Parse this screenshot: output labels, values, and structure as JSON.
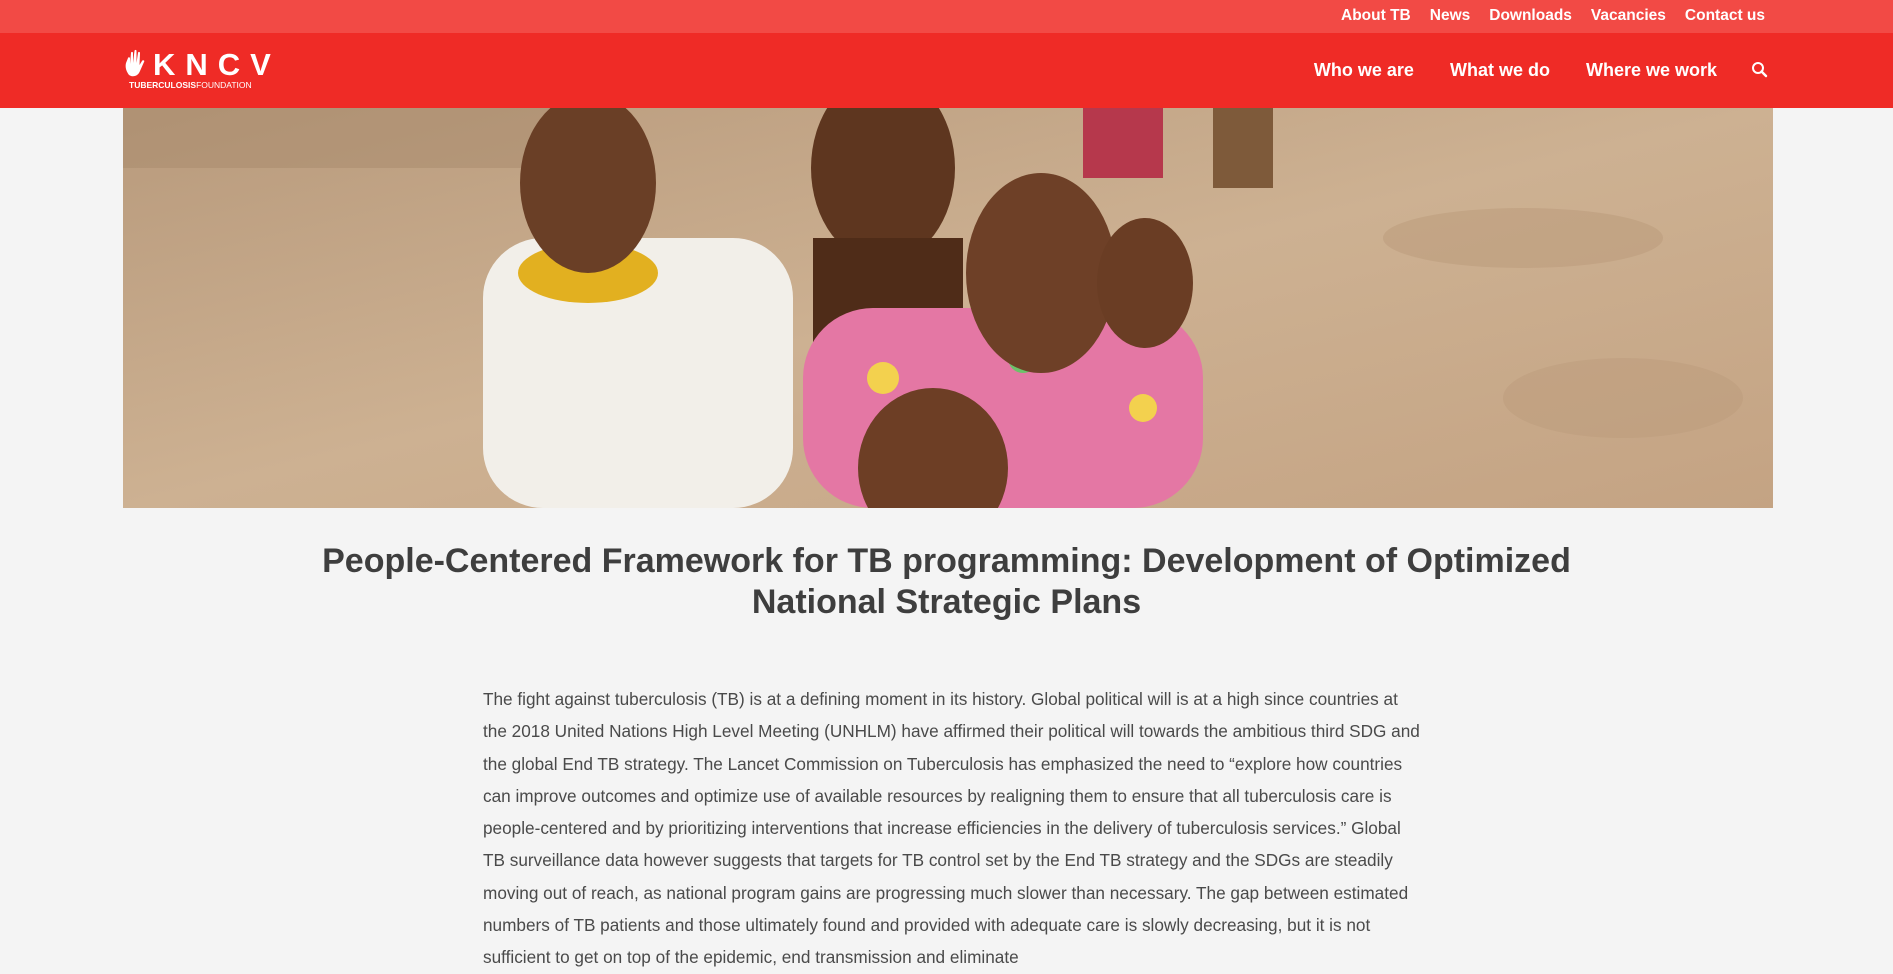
{
  "topnav": {
    "items": [
      "About TB",
      "News",
      "Downloads",
      "Vacancies",
      "Contact us"
    ]
  },
  "logo": {
    "mark": "KNCV",
    "sub_bold": "TUBERCULOSIS",
    "sub_regular": "FOUNDATION"
  },
  "mainnav": {
    "items": [
      "Who we are",
      "What we do",
      "Where we work"
    ],
    "search_icon": "search-icon"
  },
  "colors": {
    "topbar": "#f24a45",
    "mainbar": "#ef2b26",
    "background": "#f4f4f4",
    "title": "#3e3e3e",
    "text": "#4a4a4a"
  },
  "article": {
    "title": "People-Centered Framework for TB programming: Development of Optimized National Strategic Plans",
    "paragraph": "The fight against tuberculosis (TB) is at a defining moment in its history. Global political will is at a high since countries at the 2018 United Nations High Level Meeting (UNHLM) have affirmed their political will towards the ambitious third SDG and the global End TB strategy. The Lancet Commission on Tuberculosis has emphasized the need to “explore how countries can improve outcomes and optimize use of available resources by realigning them to ensure that all tuberculosis care is people-centered and by prioritizing interventions that increase efficiencies in the delivery of tuberculosis services.” Global TB surveillance data however suggests that targets for TB control set by the End TB strategy and the SDGs are steadily moving out of reach, as national program gains are progressing much slower than necessary. The gap between estimated numbers of TB patients and those ultimately found and provided with adequate care is slowly decreasing, but it is not sufficient to get on top of the epidemic, end transmission and eliminate"
  }
}
